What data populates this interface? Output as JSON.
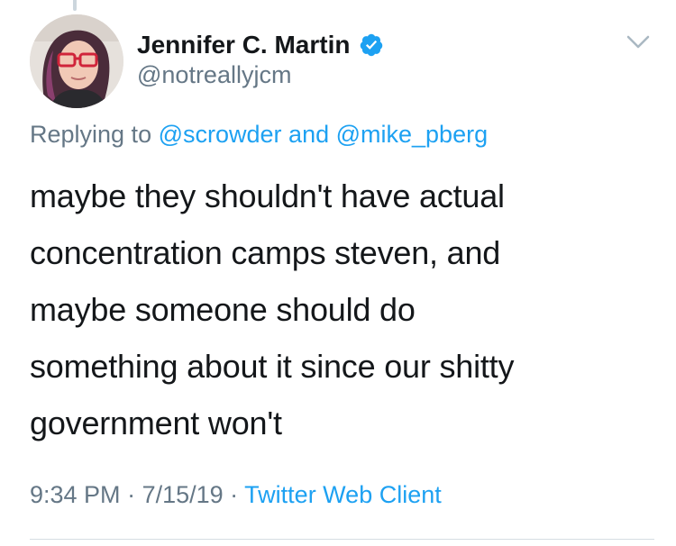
{
  "tweet": {
    "author": {
      "display_name": "Jennifer C. Martin",
      "handle": "@notreallyjcm",
      "verified": true
    },
    "replying": {
      "prefix": "Replying to ",
      "user1": "@scrowder",
      "conjunction": " and ",
      "user2": "@mike_pberg"
    },
    "text": "maybe they shouldn't have actual\nconcentration camps steven, and\nmaybe someone should do\nsomething about it since our shitty\ngovernment won't",
    "meta": {
      "time": "9:34 PM",
      "separator1": " · ",
      "date": "7/15/19",
      "separator2": " · ",
      "client": "Twitter Web Client"
    }
  },
  "colors": {
    "link": "#1da1f2",
    "secondary_text": "#657786",
    "primary_text": "#14171a",
    "verified_badge": "#1da1f2"
  },
  "icons": {
    "menu": "chevron-down-icon",
    "badge": "verified-badge-icon"
  }
}
